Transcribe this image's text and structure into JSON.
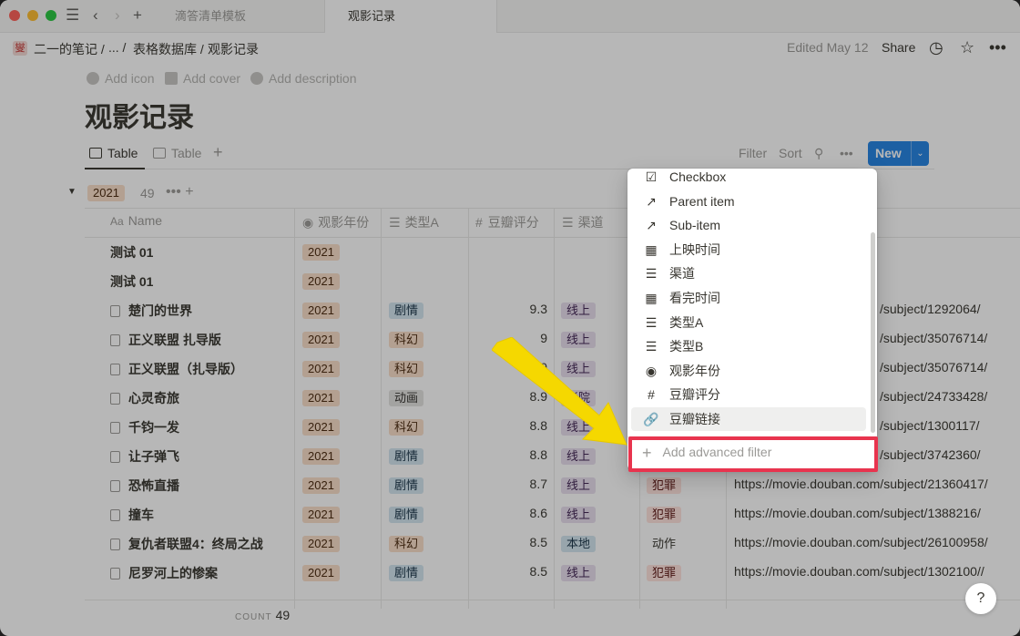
{
  "titlebar": {
    "tabs": [
      {
        "label": "滴答清单模板",
        "active": false
      },
      {
        "label": "观影记录",
        "active": true
      }
    ]
  },
  "breadcrumb": {
    "workspace_icon": "燮",
    "items": [
      "二一的笔记 /",
      "... /",
      "表格数据库 /",
      "观影记录"
    ],
    "edited": "Edited May 12",
    "share": "Share"
  },
  "page": {
    "add_icon": "Add icon",
    "add_cover": "Add cover",
    "add_description": "Add description",
    "title": "观影记录"
  },
  "views": {
    "tabs": [
      "Table",
      "Table"
    ],
    "filter": "Filter",
    "sort": "Sort",
    "new": "New"
  },
  "group": {
    "label": "2021",
    "count": "49"
  },
  "columns": [
    {
      "label": "Name",
      "icon": "Aa"
    },
    {
      "label": "观影年份",
      "icon": "select-icon"
    },
    {
      "label": "类型A",
      "icon": "list-icon"
    },
    {
      "label": "豆瓣评分",
      "icon": "#"
    },
    {
      "label": "渠道",
      "icon": "list-icon"
    }
  ],
  "rows": [
    {
      "name": "测试 01",
      "doc": false,
      "year": "2021",
      "typeA": "",
      "typeA_color": "",
      "score": "",
      "channel": "",
      "channel_color": "",
      "b": "",
      "b_color": "",
      "url": ""
    },
    {
      "name": "测试 01",
      "doc": false,
      "year": "2021",
      "typeA": "",
      "typeA_color": "",
      "score": "",
      "channel": "",
      "channel_color": "",
      "b": "",
      "b_color": "",
      "url": ""
    },
    {
      "name": "楚门的世界",
      "doc": true,
      "year": "2021",
      "typeA": "剧情",
      "typeA_color": "c-blue",
      "score": "9.3",
      "channel": "线上",
      "channel_color": "c-purple",
      "b": "",
      "b_color": "",
      "url": "/subject/1292064/"
    },
    {
      "name": "正义联盟 扎导版",
      "doc": true,
      "year": "2021",
      "typeA": "科幻",
      "typeA_color": "c-orange",
      "score": "9",
      "channel": "线上",
      "channel_color": "c-purple",
      "b": "",
      "b_color": "",
      "url": "/subject/35076714/"
    },
    {
      "name": "正义联盟（扎导版）",
      "doc": true,
      "year": "2021",
      "typeA": "科幻",
      "typeA_color": "c-orange",
      "score": "9",
      "channel": "线上",
      "channel_color": "c-purple",
      "b": "",
      "b_color": "",
      "url": "/subject/35076714/"
    },
    {
      "name": "心灵奇旅",
      "doc": true,
      "year": "2021",
      "typeA": "动画",
      "typeA_color": "c-gray",
      "score": "8.9",
      "channel": "影院",
      "channel_color": "c-purple",
      "b": "",
      "b_color": "",
      "url": "/subject/24733428/"
    },
    {
      "name": "千钧一发",
      "doc": true,
      "year": "2021",
      "typeA": "科幻",
      "typeA_color": "c-orange",
      "score": "8.8",
      "channel": "线上",
      "channel_color": "c-purple",
      "b": "",
      "b_color": "",
      "url": "/subject/1300117/"
    },
    {
      "name": "让子弹飞",
      "doc": true,
      "year": "2021",
      "typeA": "剧情",
      "typeA_color": "c-blue",
      "score": "8.8",
      "channel": "线上",
      "channel_color": "c-purple",
      "b": "",
      "b_color": "",
      "url": "/subject/3742360/"
    },
    {
      "name": "恐怖直播",
      "doc": true,
      "year": "2021",
      "typeA": "剧情",
      "typeA_color": "c-blue",
      "score": "8.7",
      "channel": "线上",
      "channel_color": "c-purple",
      "b": "犯罪",
      "b_color": "c-red",
      "url": "https://movie.douban.com/subject/21360417/"
    },
    {
      "name": "撞车",
      "doc": true,
      "year": "2021",
      "typeA": "剧情",
      "typeA_color": "c-blue",
      "score": "8.6",
      "channel": "线上",
      "channel_color": "c-purple",
      "b": "犯罪",
      "b_color": "c-red",
      "url": "https://movie.douban.com/subject/1388216/"
    },
    {
      "name": "复仇者联盟4：终局之战",
      "doc": true,
      "year": "2021",
      "typeA": "科幻",
      "typeA_color": "c-orange",
      "score": "8.5",
      "channel": "本地",
      "channel_color": "c-blue",
      "b": "动作",
      "b_color": "c-plain",
      "url": "https://movie.douban.com/subject/26100958/"
    },
    {
      "name": "尼罗河上的惨案",
      "doc": true,
      "year": "2021",
      "typeA": "剧情",
      "typeA_color": "c-blue",
      "score": "8.5",
      "channel": "线上",
      "channel_color": "c-purple",
      "b": "犯罪",
      "b_color": "c-red",
      "url": "https://movie.douban.com/subject/1302100//"
    }
  ],
  "footer": {
    "count_label": "COUNT",
    "count_value": "49"
  },
  "menu": {
    "items": [
      {
        "label": "Checkbox",
        "icon": "checkbox-icon"
      },
      {
        "label": "Parent item",
        "icon": "arrow-up-right-icon"
      },
      {
        "label": "Sub-item",
        "icon": "arrow-up-right-icon"
      },
      {
        "label": "上映时间",
        "icon": "calendar-icon"
      },
      {
        "label": "渠道",
        "icon": "list-icon"
      },
      {
        "label": "看完时间",
        "icon": "calendar-icon"
      },
      {
        "label": "类型A",
        "icon": "list-icon"
      },
      {
        "label": "类型B",
        "icon": "list-icon"
      },
      {
        "label": "观影年份",
        "icon": "select-icon"
      },
      {
        "label": "豆瓣评分",
        "icon": "number-icon"
      },
      {
        "label": "豆瓣链接",
        "icon": "link-icon"
      }
    ],
    "hovered_index": 10,
    "advanced": "Add advanced filter"
  },
  "help": "?",
  "colors": {
    "accent": "#2383e2",
    "highlight_box": "#e8344e",
    "annotation_arrow": "#f5d800"
  }
}
